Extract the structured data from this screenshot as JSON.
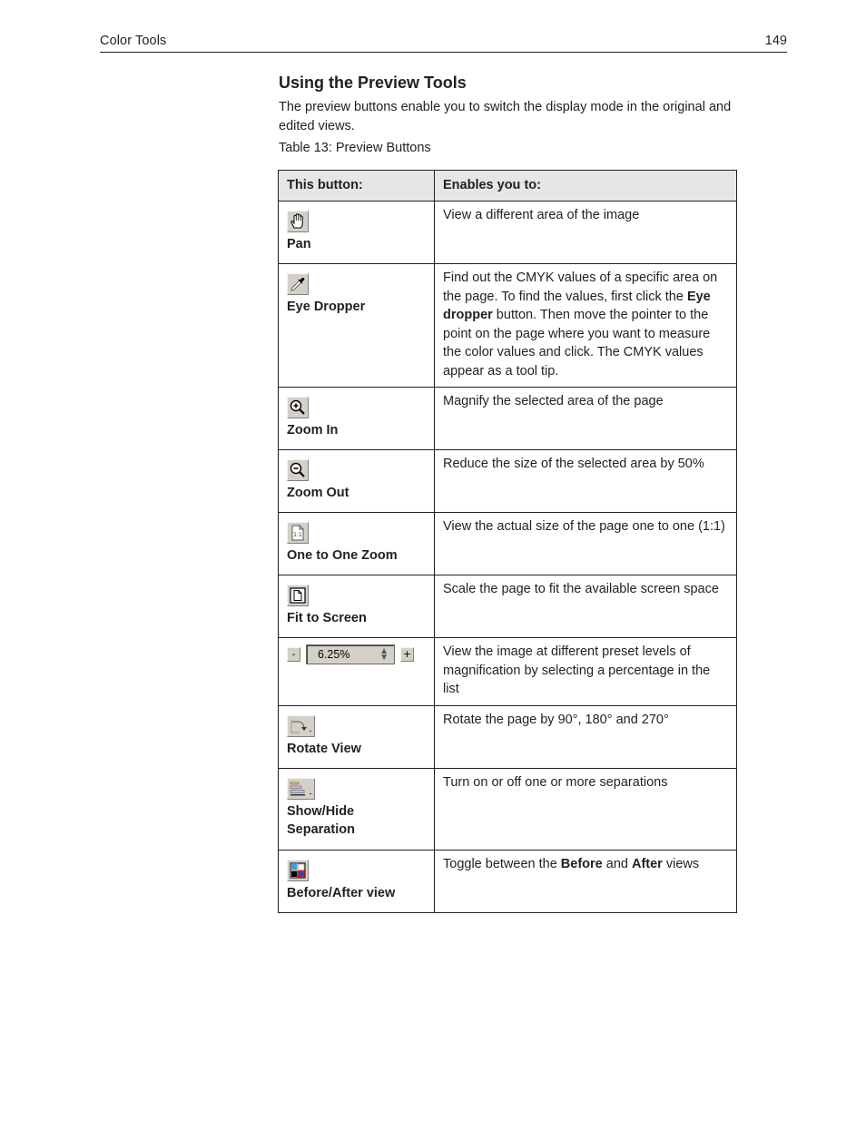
{
  "header": {
    "section": "Color Tools",
    "page_number": "149"
  },
  "main": {
    "title": "Using the Preview Tools",
    "intro": "The preview buttons enable you to switch the display mode in the original and edited views.",
    "caption": "Table 13: Preview Buttons",
    "table": {
      "headers": [
        "This button:",
        "Enables you to:"
      ],
      "rows": [
        {
          "icon": "pan-hand-icon",
          "name": "Pan",
          "desc": "View a different area of the image"
        },
        {
          "icon": "eye-dropper-icon",
          "name": "Eye Dropper",
          "desc_parts": [
            "Find out the CMYK values of a specific area on the page. To find the values, first click the ",
            "Eye dropper",
            " button. Then move the pointer to the point on the page where you want to measure the color values and click. The CMYK values appear as a tool tip."
          ]
        },
        {
          "icon": "zoom-in-icon",
          "name": "Zoom In",
          "desc": "Magnify the selected area of the page"
        },
        {
          "icon": "zoom-out-icon",
          "name": "Zoom Out",
          "desc": "Reduce the size of the selected area by 50%"
        },
        {
          "icon": "one-to-one-zoom-icon",
          "name": "One to One Zoom",
          "desc": "View the actual size of the page one to one (1:1)"
        },
        {
          "icon": "fit-to-screen-icon",
          "name": "Fit to Screen",
          "desc": "Scale the page to fit the available screen space"
        },
        {
          "icon": "zoom-level-control",
          "name": "",
          "zoom_value": "6.25%",
          "minus": "-",
          "plus": "+",
          "desc": "View the image at different preset levels of magnification by selecting a percentage in the list"
        },
        {
          "icon": "rotate-view-icon",
          "name": "Rotate View",
          "desc": "Rotate the page by 90°, 180° and 270°"
        },
        {
          "icon": "show-hide-separation-icon",
          "name": "Show/Hide Separation",
          "desc": "Turn on or off one or more separations"
        },
        {
          "icon": "before-after-view-icon",
          "name": "Before/After view",
          "desc_parts": [
            "Toggle between the ",
            "Before",
            " and ",
            "After",
            " views"
          ]
        }
      ]
    }
  }
}
